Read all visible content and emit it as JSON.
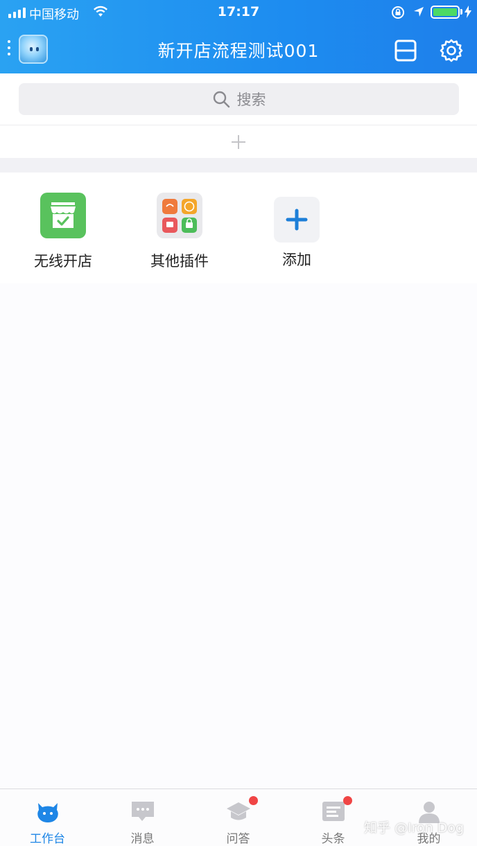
{
  "status_bar": {
    "carrier": "中国移动",
    "time": "17:17"
  },
  "nav": {
    "title": "新开店流程测试001"
  },
  "search": {
    "placeholder": "搜索"
  },
  "apps": [
    {
      "label": "无线开店",
      "icon": "store-icon"
    },
    {
      "label": "其他插件",
      "icon": "plugins-icon"
    },
    {
      "label": "添加",
      "icon": "plus-icon"
    }
  ],
  "tabs": [
    {
      "label": "工作台",
      "icon": "workbench-icon",
      "active": true
    },
    {
      "label": "消息",
      "icon": "message-icon",
      "badge": false
    },
    {
      "label": "问答",
      "icon": "graduation-cap-icon",
      "badge": true
    },
    {
      "label": "头条",
      "icon": "news-icon",
      "badge": true
    },
    {
      "label": "我的",
      "icon": "profile-icon",
      "badge": false
    }
  ],
  "watermark": "知乎 @Iron Dog",
  "colors": {
    "header_start": "#2aa2f2",
    "header_end": "#1e7fea",
    "active_tab": "#1e86e6",
    "badge": "#f04545",
    "store_green": "#59c25d",
    "add_blue": "#1d7fd8"
  }
}
